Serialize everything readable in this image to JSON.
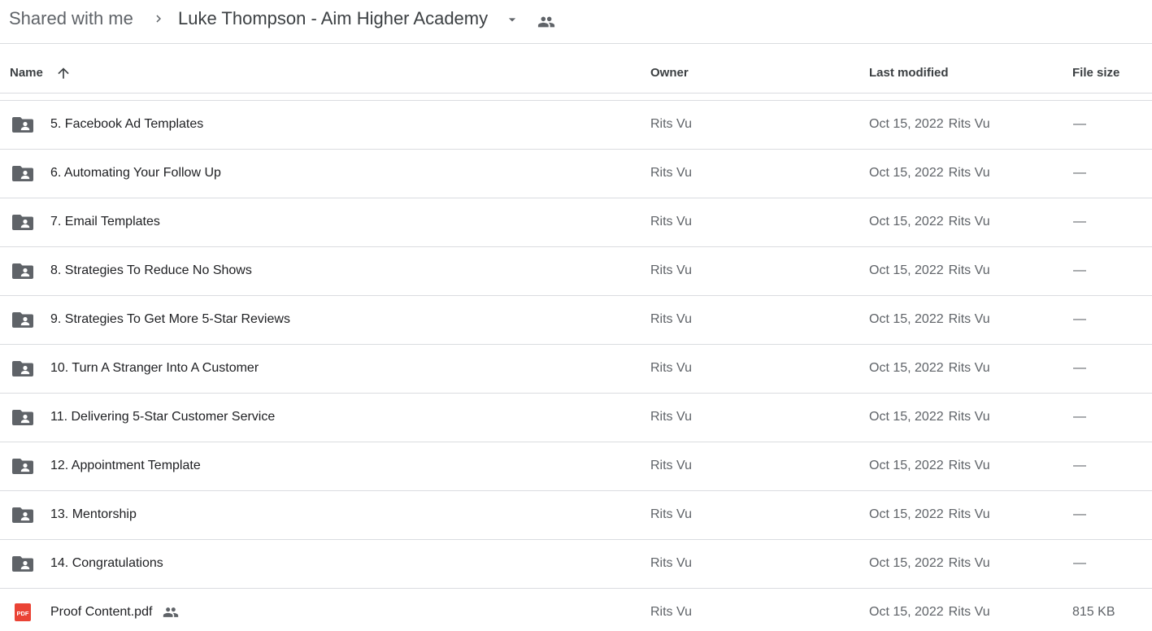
{
  "breadcrumb": {
    "root": "Shared with me",
    "current": "Luke Thompson - Aim Higher Academy",
    "separator_icon": "chevron-right-icon",
    "dropdown_icon": "caret-down-icon",
    "shared_icon": "people-icon"
  },
  "columns": {
    "name": "Name",
    "owner": "Owner",
    "last_modified": "Last modified",
    "file_size": "File size",
    "sort_icon": "arrow-up-icon"
  },
  "colors": {
    "folder_icon": "#5f6368",
    "pdf_icon": "#ea4335",
    "divider": "#dadce0"
  },
  "rows": [
    {
      "name": "5. Facebook Ad Templates",
      "type": "shared-folder",
      "owner": "Rits Vu",
      "date": "Oct 15, 2022",
      "modified_by": "Rits Vu",
      "size": "—"
    },
    {
      "name": "6. Automating Your Follow Up",
      "type": "shared-folder",
      "owner": "Rits Vu",
      "date": "Oct 15, 2022",
      "modified_by": "Rits Vu",
      "size": "—"
    },
    {
      "name": "7. Email Templates",
      "type": "shared-folder",
      "owner": "Rits Vu",
      "date": "Oct 15, 2022",
      "modified_by": "Rits Vu",
      "size": "—"
    },
    {
      "name": "8. Strategies To Reduce No Shows",
      "type": "shared-folder",
      "owner": "Rits Vu",
      "date": "Oct 15, 2022",
      "modified_by": "Rits Vu",
      "size": "—"
    },
    {
      "name": "9. Strategies To Get More 5-Star Reviews",
      "type": "shared-folder",
      "owner": "Rits Vu",
      "date": "Oct 15, 2022",
      "modified_by": "Rits Vu",
      "size": "—"
    },
    {
      "name": "10. Turn A Stranger Into A Customer",
      "type": "shared-folder",
      "owner": "Rits Vu",
      "date": "Oct 15, 2022",
      "modified_by": "Rits Vu",
      "size": "—"
    },
    {
      "name": "11. Delivering 5-Star Customer Service",
      "type": "shared-folder",
      "owner": "Rits Vu",
      "date": "Oct 15, 2022",
      "modified_by": "Rits Vu",
      "size": "—"
    },
    {
      "name": "12. Appointment Template",
      "type": "shared-folder",
      "owner": "Rits Vu",
      "date": "Oct 15, 2022",
      "modified_by": "Rits Vu",
      "size": "—"
    },
    {
      "name": "13. Mentorship",
      "type": "shared-folder",
      "owner": "Rits Vu",
      "date": "Oct 15, 2022",
      "modified_by": "Rits Vu",
      "size": "—"
    },
    {
      "name": "14. Congratulations",
      "type": "shared-folder",
      "owner": "Rits Vu",
      "date": "Oct 15, 2022",
      "modified_by": "Rits Vu",
      "size": "—"
    },
    {
      "name": "Proof Content.pdf",
      "type": "pdf",
      "shared": true,
      "pdf_badge": "PDF",
      "owner": "Rits Vu",
      "date": "Oct 15, 2022",
      "modified_by": "Rits Vu",
      "size": "815 KB"
    }
  ]
}
